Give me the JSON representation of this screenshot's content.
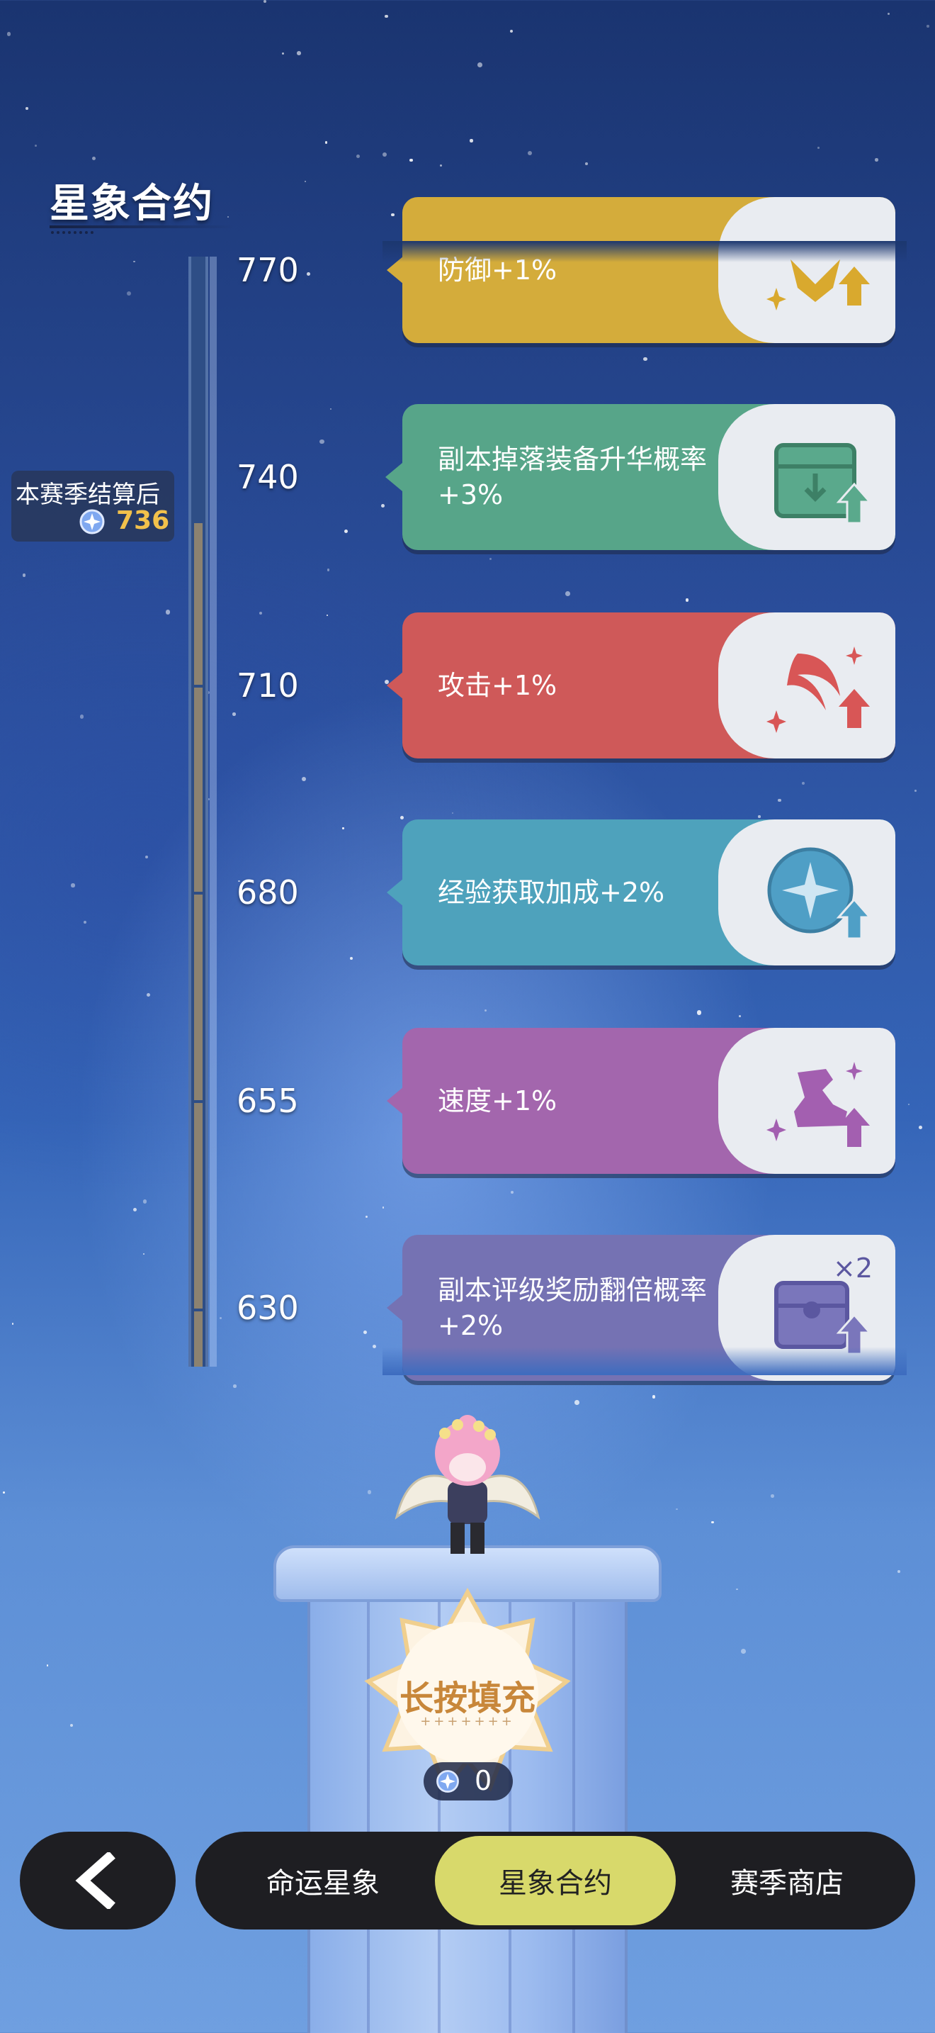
{
  "title": "星象合约",
  "marker": {
    "label": "本赛季结算后",
    "value": "736",
    "icon": "star-orb-icon"
  },
  "progress": {
    "current": 736,
    "max": 770,
    "min": 630
  },
  "rows": [
    {
      "level": "770",
      "text": "防御+1%",
      "color": "#d4ac3b",
      "icon": "shield-up-icon"
    },
    {
      "level": "740",
      "text": "副本掉落装备升华概率+3%",
      "color": "#57a589",
      "icon": "box-up-icon"
    },
    {
      "level": "710",
      "text": "攻击+1%",
      "color": "#cf5959",
      "icon": "slash-up-icon"
    },
    {
      "level": "680",
      "text": "经验获取加成+2%",
      "color": "#4ea2bc",
      "icon": "compass-up-icon"
    },
    {
      "level": "655",
      "text": "速度+1%",
      "color": "#a366ad",
      "icon": "boot-up-icon"
    },
    {
      "level": "630",
      "text": "副本评级奖励翻倍概率+2%",
      "color": "#7572b3",
      "icon": "chest-x2-icon",
      "badge": "×2"
    }
  ],
  "fill_button": {
    "label": "长按填充"
  },
  "counter": {
    "value": "0",
    "icon": "star-orb-icon"
  },
  "nav": {
    "back_icon": "chevron-left-icon",
    "tabs": [
      {
        "label": "命运星象",
        "active": false
      },
      {
        "label": "星象合约",
        "active": true
      },
      {
        "label": "赛季商店",
        "active": false
      }
    ]
  }
}
